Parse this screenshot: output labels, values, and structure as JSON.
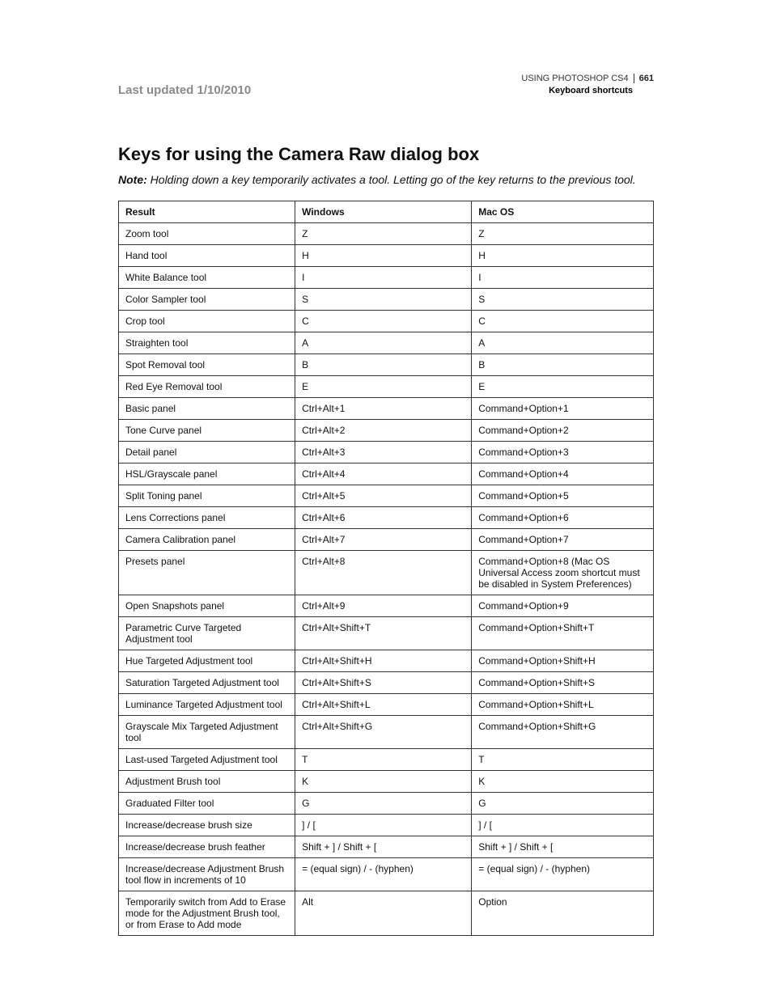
{
  "header": {
    "last_updated": "Last updated 1/10/2010",
    "doc_title": "USING PHOTOSHOP CS4",
    "page_number": "661",
    "section_nav": "Keyboard shortcuts"
  },
  "section": {
    "title": "Keys for using the Camera Raw dialog box",
    "note_label": "Note:",
    "note_body": " Holding down a key temporarily activates a tool. Letting go of the key returns to the previous tool."
  },
  "table": {
    "headers": {
      "result": "Result",
      "windows": "Windows",
      "mac": "Mac OS"
    },
    "rows": [
      {
        "result": "Zoom tool",
        "windows": "Z",
        "mac": "Z"
      },
      {
        "result": "Hand tool",
        "windows": "H",
        "mac": "H"
      },
      {
        "result": "White Balance tool",
        "windows": "I",
        "mac": "I"
      },
      {
        "result": "Color Sampler tool",
        "windows": "S",
        "mac": "S"
      },
      {
        "result": "Crop tool",
        "windows": "C",
        "mac": "C"
      },
      {
        "result": "Straighten tool",
        "windows": "A",
        "mac": "A"
      },
      {
        "result": "Spot Removal tool",
        "windows": "B",
        "mac": "B"
      },
      {
        "result": "Red Eye Removal tool",
        "windows": "E",
        "mac": "E"
      },
      {
        "result": "Basic panel",
        "windows": "Ctrl+Alt+1",
        "mac": "Command+Option+1"
      },
      {
        "result": "Tone Curve panel",
        "windows": "Ctrl+Alt+2",
        "mac": "Command+Option+2"
      },
      {
        "result": "Detail panel",
        "windows": "Ctrl+Alt+3",
        "mac": "Command+Option+3"
      },
      {
        "result": "HSL/Grayscale panel",
        "windows": "Ctrl+Alt+4",
        "mac": "Command+Option+4"
      },
      {
        "result": "Split Toning panel",
        "windows": "Ctrl+Alt+5",
        "mac": "Command+Option+5"
      },
      {
        "result": "Lens Corrections panel",
        "windows": "Ctrl+Alt+6",
        "mac": "Command+Option+6"
      },
      {
        "result": "Camera Calibration panel",
        "windows": "Ctrl+Alt+7",
        "mac": "Command+Option+7"
      },
      {
        "result": "Presets panel",
        "windows": "Ctrl+Alt+8",
        "mac": "Command+Option+8 (Mac OS Universal Access zoom shortcut must be disabled in System Preferences)"
      },
      {
        "result": "Open Snapshots panel",
        "windows": "Ctrl+Alt+9",
        "mac": "Command+Option+9"
      },
      {
        "result": "Parametric Curve Targeted Adjustment tool",
        "windows": "Ctrl+Alt+Shift+T",
        "mac": "Command+Option+Shift+T"
      },
      {
        "result": "Hue Targeted Adjustment tool",
        "windows": "Ctrl+Alt+Shift+H",
        "mac": "Command+Option+Shift+H"
      },
      {
        "result": "Saturation Targeted Adjustment tool",
        "windows": "Ctrl+Alt+Shift+S",
        "mac": "Command+Option+Shift+S"
      },
      {
        "result": "Luminance Targeted Adjustment tool",
        "windows": "Ctrl+Alt+Shift+L",
        "mac": "Command+Option+Shift+L"
      },
      {
        "result": "Grayscale Mix Targeted Adjustment tool",
        "windows": "Ctrl+Alt+Shift+G",
        "mac": "Command+Option+Shift+G"
      },
      {
        "result": "Last-used Targeted Adjustment tool",
        "windows": "T",
        "mac": "T"
      },
      {
        "result": "Adjustment Brush tool",
        "windows": "K",
        "mac": "K"
      },
      {
        "result": "Graduated Filter tool",
        "windows": "G",
        "mac": "G"
      },
      {
        "result": "Increase/decrease brush size",
        "windows": "] / [",
        "mac": "] / ["
      },
      {
        "result": "Increase/decrease brush feather",
        "windows": "Shift + ] / Shift + [",
        "mac": "Shift + ] / Shift + ["
      },
      {
        "result": "Increase/decrease Adjustment Brush tool flow in increments of 10",
        "windows": "= (equal sign) / - (hyphen)",
        "mac": "= (equal sign) / - (hyphen)"
      },
      {
        "result": "Temporarily switch from Add to Erase mode for the Adjustment Brush tool, or from Erase to Add mode",
        "windows": "Alt",
        "mac": "Option"
      }
    ]
  }
}
